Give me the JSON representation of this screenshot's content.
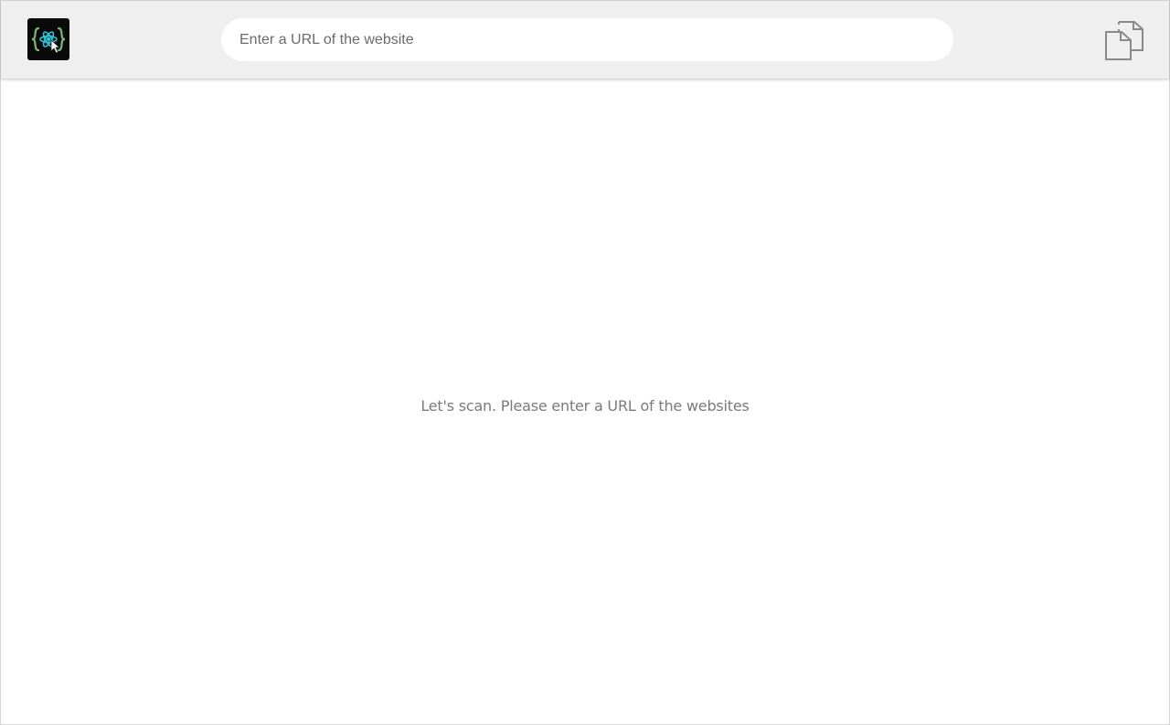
{
  "header": {
    "logo": {
      "icon": "atom-cursor-logo-icon",
      "background": "#0a0a0a",
      "accent": "#2ec4d6"
    },
    "search": {
      "placeholder": "Enter a URL of the website",
      "value": ""
    },
    "copy_button": {
      "icon": "copy-documents-icon",
      "color": "#8a8a8a"
    }
  },
  "main": {
    "empty_message": "Let's scan. Please enter a URL of the websites"
  }
}
